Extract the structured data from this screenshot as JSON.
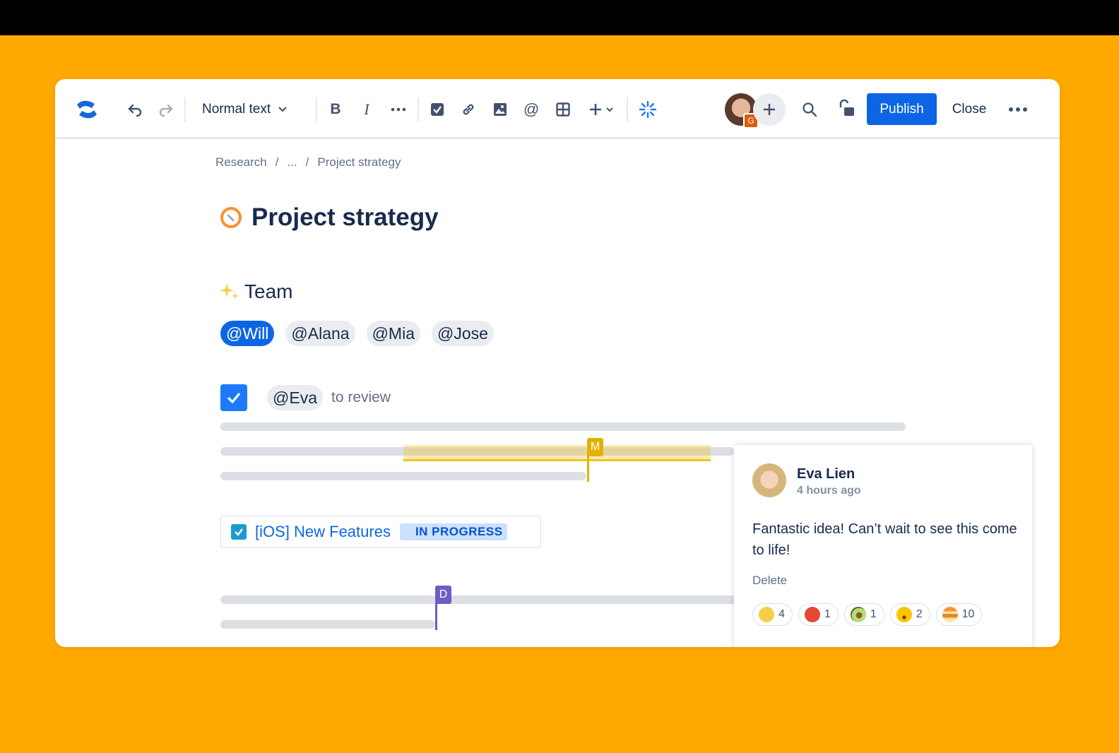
{
  "toolbar": {
    "text_style": "Normal text",
    "collaborator_badge": "G",
    "publish_label": "Publish",
    "close_label": "Close"
  },
  "breadcrumb": {
    "root": "Research",
    "middle": "...",
    "current": "Project strategy",
    "separator": "/"
  },
  "page": {
    "title": "Project strategy",
    "section_heading": "Team",
    "mentions": [
      "@Will",
      "@Alana",
      "@Mia",
      "@Jose"
    ],
    "task": {
      "mention": "@Eva",
      "text": "to review"
    }
  },
  "cursors": {
    "first": "M",
    "second": "D"
  },
  "jira": {
    "title": "[iOS] New Features",
    "status": "IN PROGRESS"
  },
  "comment": {
    "author": "Eva Lien",
    "time": "4 hours ago",
    "body": "Fantastic idea! Can’t wait to see this come to life!",
    "delete_label": "Delete",
    "reactions": [
      {
        "icon": "clapping-hands-icon",
        "count": "4"
      },
      {
        "icon": "tomato-icon",
        "count": "1"
      },
      {
        "icon": "avocado-icon",
        "count": "1"
      },
      {
        "icon": "astonished-face-icon",
        "count": "2"
      },
      {
        "icon": "pancakes-icon",
        "count": "10"
      }
    ]
  },
  "colors": {
    "background": "#FFA800",
    "primary": "#0C66E4",
    "cursor_m": "#E2B203",
    "cursor_d": "#6E5DC6"
  }
}
